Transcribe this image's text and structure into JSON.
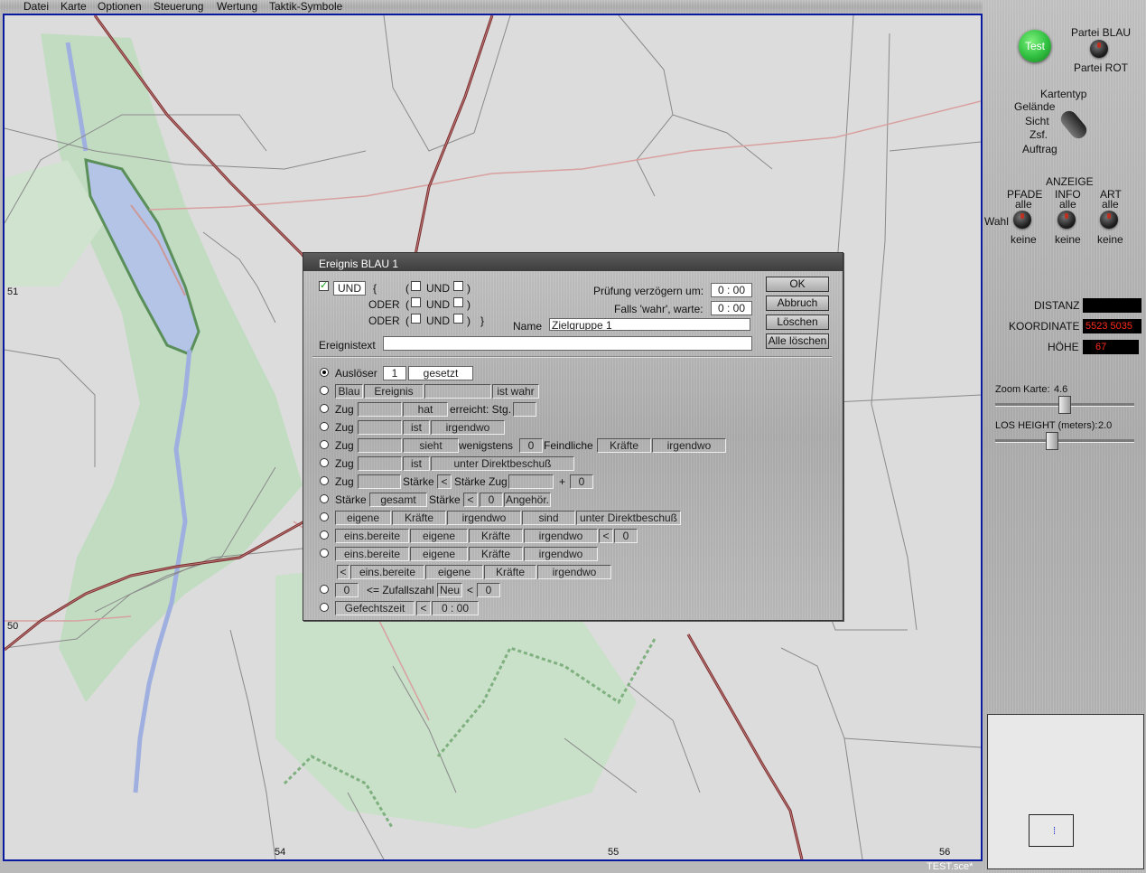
{
  "menu": [
    "Datei",
    "Karte",
    "Optionen",
    "Steuerung",
    "Wertung",
    "Taktik-Symbole"
  ],
  "map": {
    "grid_x": [
      "54",
      "55",
      "56"
    ],
    "grid_y": [
      "51",
      "50"
    ],
    "filename": "TEST.sce*"
  },
  "panel": {
    "test_label": "Test",
    "partei_blau": "Partei BLAU",
    "partei_rot": "Partei ROT",
    "kartentyp": "Kartentyp",
    "kartentyp_options": [
      "Gelände",
      "Sicht",
      "Zsf.",
      "Auftrag"
    ],
    "anzeige": "ANZEIGE",
    "pfade": "PFADE",
    "info": "INFO",
    "art": "ART",
    "alle": "alle",
    "keine": "keine",
    "wahl": "Wahl",
    "distanz_label": "DISTANZ",
    "distanz_value": "",
    "koordinate_label": "KOORDINATE",
    "koordinate_value": "5523 5035",
    "hoehe_label": "HÖHE",
    "hoehe_value": "67",
    "zoom_label": "Zoom Karte:",
    "zoom_value": "4.6",
    "los_label": "LOS HEIGHT (meters):",
    "los_value": "2.0"
  },
  "dialog": {
    "title": "Ereignis BLAU 1",
    "und": "UND",
    "oder": "ODER",
    "open_brace": "{",
    "close_brace": "}",
    "open_paren": "(",
    "close_paren": ")",
    "pruefung_label": "Prüfung verzögern um:",
    "pruefung_value": "0 : 00",
    "falls_label": "Falls 'wahr', warte:",
    "falls_value": "0 : 00",
    "name_label": "Name",
    "name_value": "Zielgruppe 1",
    "ereignistext_label": "Ereignistext",
    "ereignistext_value": "",
    "buttons": {
      "ok": "OK",
      "abbruch": "Abbruch",
      "loeschen": "Löschen",
      "alle_loeschen": "Alle löschen"
    },
    "rows": {
      "r1": {
        "a": "Auslöser",
        "b": "1",
        "c": "gesetzt"
      },
      "r2": {
        "a": "Blau",
        "b": "Ereignis",
        "c": "",
        "d": "ist wahr"
      },
      "r3": {
        "a": "Zug",
        "b": "",
        "c": "hat",
        "d": "erreicht: Stg.",
        "e": ""
      },
      "r4": {
        "a": "Zug",
        "b": "",
        "c": "ist",
        "d": "irgendwo"
      },
      "r5": {
        "a": "Zug",
        "b": "",
        "c": "sieht",
        "d": "wenigstens",
        "e": "0",
        "f": "Feindliche",
        "g": "Kräfte",
        "h": "irgendwo"
      },
      "r6": {
        "a": "Zug",
        "b": "",
        "c": "ist",
        "d": "unter Direktbeschuß"
      },
      "r7": {
        "a": "Zug",
        "b": "",
        "c": "Stärke",
        "d": "<",
        "e": "Stärke Zug",
        "f": "",
        "g": "+",
        "h": "0"
      },
      "r8": {
        "a": "Stärke",
        "b": "gesamt",
        "c": "Stärke",
        "d": "<",
        "e": "0",
        "f": "Angehör."
      },
      "r9": {
        "a": "eigene",
        "b": "Kräfte",
        "c": "irgendwo",
        "d": "sind",
        "e": "unter Direktbeschuß"
      },
      "r10": {
        "a": "eins.bereite",
        "b": "eigene",
        "c": "Kräfte",
        "d": "irgendwo",
        "e": "<",
        "f": "0"
      },
      "r11": {
        "a": "eins.bereite",
        "b": "eigene",
        "c": "Kräfte",
        "d": "irgendwo"
      },
      "r11b": {
        "a": "<",
        "b": "eins.bereite",
        "c": "eigene",
        "d": "Kräfte",
        "e": "irgendwo"
      },
      "r12": {
        "a": "0",
        "b": "<= Zufallszahl",
        "c": "Neu",
        "d": "<",
        "e": "0"
      },
      "r13": {
        "a": "Gefechtszeit",
        "b": "<",
        "c": "0 : 00"
      }
    }
  },
  "colors": {
    "map_border": "#0a1a9e",
    "road": "#7a2a2a",
    "water": "#b4c4e6",
    "forest": "#c2dcc2",
    "readout_text": "#ff2a1a",
    "test_button": "#2fbf3f"
  }
}
